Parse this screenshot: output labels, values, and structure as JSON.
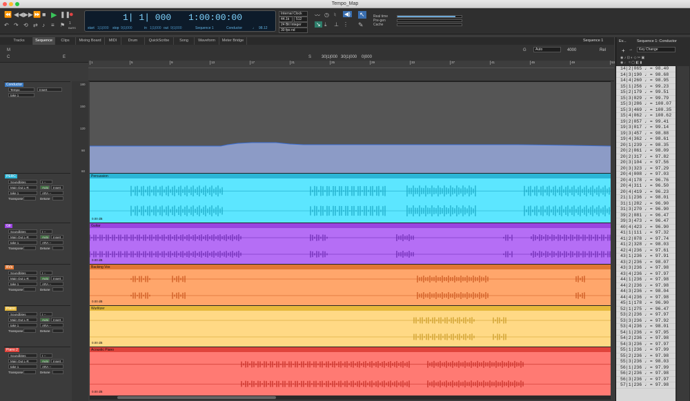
{
  "window": {
    "title": "Tempo_Map"
  },
  "transport": {
    "main_counter": "1| 1| 000",
    "sub_counter": "1:00:00:00",
    "start_label": "start",
    "start_val": "1|1|000",
    "stop_label": "stop",
    "stop_val": "9|1|000",
    "in_label": "in",
    "in_val": "1|1|000",
    "out_label": "out",
    "out_val": "9|1|000",
    "sequence_label": "Sequence 1",
    "conductor_label": "Conductor",
    "tempo": "98.12",
    "clock": "Internal Clock",
    "rate": "44.1k",
    "buffer": "512",
    "bitdepth": "24 Bit Integer",
    "fps": "30 fps nd",
    "realtime": "Real time",
    "pregen": "Pre-gen",
    "cache": "Cache",
    "bars_label": "BARS",
    "bars_val": "1"
  },
  "tabs": [
    {
      "label": "Tracks"
    },
    {
      "label": "Sequence"
    },
    {
      "label": "Clips"
    },
    {
      "label": "Mixing Board"
    },
    {
      "label": "MIDI"
    },
    {
      "label": "Drum"
    },
    {
      "label": "QuickScribe"
    },
    {
      "label": "Song"
    },
    {
      "label": "Waveform"
    },
    {
      "label": "Meter Bridge"
    }
  ],
  "sequence_menu": "Sequence 1",
  "toolbar": {
    "m": "M",
    "c": "C",
    "e": "E",
    "s": "S",
    "sel_start": "30|1|000",
    "sel_end": "30|1|000",
    "sel_len": "0|000",
    "zoom_label": "Auto",
    "g": "G",
    "samples": "4000",
    "rel": "Rel"
  },
  "ruler": {
    "ticks": [
      "1",
      "5",
      "9",
      "13",
      "17",
      "21",
      "25",
      "29",
      "33",
      "37",
      "41",
      "45",
      "49",
      "53"
    ]
  },
  "conductor": {
    "name": "Conductor",
    "param": "Tempo",
    "insert": "Insert",
    "take": "take 1",
    "scale": [
      "180",
      "150",
      "120",
      "90",
      "60"
    ]
  },
  "tracks": [
    {
      "name": "PERC",
      "clip": "Percussion",
      "color": "#5ce6ff",
      "dark": "#1aa8c4",
      "head": "#2bb5d6"
    },
    {
      "name": "Gtr",
      "clip": "Guitar",
      "color": "#b56ef5",
      "dark": "#6b28b0",
      "head": "#9a43e0"
    },
    {
      "name": "BVs",
      "clip": "Backing Vox",
      "color": "#ffa66b",
      "dark": "#c9541c",
      "head": "#e07633"
    },
    {
      "name": "Piano",
      "clip": "Wurlitzer",
      "color": "#ffd985",
      "dark": "#c99a24",
      "head": "#e6b93c"
    },
    {
      "name": "Piano 2",
      "clip": "Acoustic Piano",
      "color": "#ff7a73",
      "dark": "#c22a22",
      "head": "#e0443c"
    }
  ],
  "track_fields": {
    "soundbites": "Soundbites",
    "routing": "Main Out L-R",
    "auto": "Auto",
    "insert": "Insert",
    "take": "take 1",
    "ara": "ARA --",
    "transpose": "Transpose",
    "detune": "Detune",
    "volume": "0.00 dB"
  },
  "right_panel": {
    "ev_tab": "Ev...",
    "seq_title": "Sequence 1: Conductor",
    "key_change": "Key Change",
    "events": [
      "14|2|065 ♩ = 98.40",
      "14|3|190 ♩ = 98.68",
      "14|4|260 ♩ = 98.95",
      "15|1|256 ♩ = 99.23",
      "15|2|179 ♩ = 99.51",
      "15|3|029 ♩ = 99.79",
      "15|3|286 ♩ = 100.07",
      "15|3|469 ♩ = 100.35",
      "15|4|062 ♩ = 100.62",
      "19|2|057 ♩ = 99.41",
      "19|3|017 ♩ = 99.14",
      "19|3|457 ♩ = 98.88",
      "19|4|362 ♩ = 98.61",
      "20|1|239 ♩ = 98.35",
      "20|2|061 ♩ = 98.09",
      "20|2|317 ♩ = 97.82",
      "20|3|104 ♩ = 97.56",
      "20|3|323 ♩ = 97.29",
      "20|4|008 ♩ = 97.03",
      "20|4|178 ♩ = 96.76",
      "20|4|311 ♩ = 96.50",
      "20|4|419 ♩ = 96.23",
      "21|1|236 ♩ = 98.01",
      "31|1|282 ♩ = 96.90",
      "31|3|270 ♩ = 96.90",
      "39|2|081 ♩ = 96.47",
      "39|3|473 ♩ = 96.47",
      "40|4|423 ♩ = 96.90",
      "41|1|111 ♩ = 97.32",
      "41|2|078 ♩ = 97.74",
      "41|2|328 ♩ = 98.03",
      "42|4|236 ♩ = 97.61",
      "43|1|236 ♩ = 97.91",
      "43|2|236 ♩ = 98.07",
      "43|3|236 ♩ = 97.98",
      "43|4|236 ♩ = 97.97",
      "44|1|236 ♩ = 97.98",
      "44|2|236 ♩ = 97.98",
      "44|3|236 ♩ = 98.04",
      "44|4|236 ♩ = 97.98",
      "45|1|178 ♩ = 96.90",
      "52|1|275 ♩ = 96.47",
      "53|2|236 ♩ = 97.97",
      "53|3|236 ♩ = 97.92",
      "53|4|236 ♩ = 98.01",
      "54|1|236 ♩ = 97.95",
      "54|2|236 ♩ = 97.98",
      "54|3|236 ♩ = 97.97",
      "55|1|236 ♩ = 97.99",
      "55|2|236 ♩ = 97.98",
      "55|3|236 ♩ = 98.03",
      "56|1|236 ♩ = 97.99",
      "56|2|236 ♩ = 97.98",
      "56|3|236 ♩ = 97.97",
      "57|1|236 ♩ = 97.98"
    ]
  }
}
